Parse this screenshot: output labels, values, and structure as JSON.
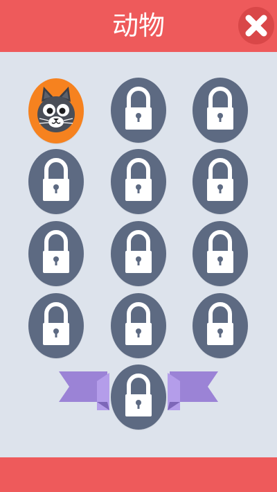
{
  "header": {
    "title": "动物",
    "close_icon": "close-x-icon"
  },
  "colors": {
    "header_bg": "#ee5a5b",
    "background": "#dde3ec",
    "locked_bg": "#5d6a82",
    "unlocked_bg": "#f6821f",
    "ribbon": "#9b83d6"
  },
  "levels": [
    {
      "state": "unlocked",
      "icon": "cat-icon"
    },
    {
      "state": "locked",
      "icon": "lock-icon"
    },
    {
      "state": "locked",
      "icon": "lock-icon"
    },
    {
      "state": "locked",
      "icon": "lock-icon"
    },
    {
      "state": "locked",
      "icon": "lock-icon"
    },
    {
      "state": "locked",
      "icon": "lock-icon"
    },
    {
      "state": "locked",
      "icon": "lock-icon"
    },
    {
      "state": "locked",
      "icon": "lock-icon"
    },
    {
      "state": "locked",
      "icon": "lock-icon"
    },
    {
      "state": "locked",
      "icon": "lock-icon"
    },
    {
      "state": "locked",
      "icon": "lock-icon"
    },
    {
      "state": "locked",
      "icon": "lock-icon"
    }
  ],
  "bonus_level": {
    "state": "locked",
    "icon": "lock-icon",
    "decoration": "ribbon-banner"
  }
}
